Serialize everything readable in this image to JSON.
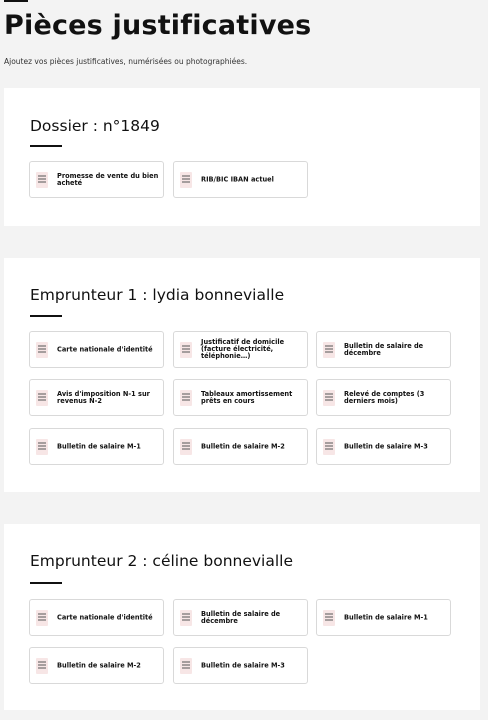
{
  "page": {
    "title": "Pièces justificatives",
    "subtitle": "Ajoutez vos pièces justificatives, numérisées ou photographiées."
  },
  "sections": [
    {
      "title": "Dossier : n°1849",
      "documents": [
        {
          "label": "Promesse de vente du bien acheté",
          "icon": "document-icon"
        },
        {
          "label": "RIB/BIC IBAN actuel",
          "icon": "document-icon"
        }
      ]
    },
    {
      "title": "Emprunteur 1 : lydia bonnevialle",
      "documents": [
        {
          "label": "Carte nationale d'identité",
          "icon": "document-icon"
        },
        {
          "label": "Justificatif de domicile (facture électricité, téléphonie…)",
          "icon": "document-icon"
        },
        {
          "label": "Bulletin de salaire de décembre",
          "icon": "document-icon"
        },
        {
          "label": "Avis d'imposition N-1 sur revenus N-2",
          "icon": "document-icon"
        },
        {
          "label": "Tableaux amortissement prêts en cours",
          "icon": "document-icon"
        },
        {
          "label": "Relevé de comptes (3 derniers mois)",
          "icon": "document-icon"
        },
        {
          "label": "Bulletin de salaire M-1",
          "icon": "document-icon"
        },
        {
          "label": "Bulletin de salaire M-2",
          "icon": "document-icon"
        },
        {
          "label": "Bulletin de salaire M-3",
          "icon": "document-icon"
        }
      ]
    },
    {
      "title": "Emprunteur 2 : céline bonnevialle",
      "documents": [
        {
          "label": "Carte nationale d'identité",
          "icon": "document-icon"
        },
        {
          "label": "Bulletin de salaire de décembre",
          "icon": "document-icon"
        },
        {
          "label": "Bulletin de salaire M-1",
          "icon": "document-icon"
        },
        {
          "label": "Bulletin de salaire M-2",
          "icon": "document-icon"
        },
        {
          "label": "Bulletin de salaire M-3",
          "icon": "document-icon"
        }
      ]
    }
  ],
  "colors": {
    "background": "#f3f3f3",
    "card": "#ffffff",
    "icon_bg": "#f7e6e6",
    "icon_lines": "#555555",
    "text": "#111111"
  }
}
